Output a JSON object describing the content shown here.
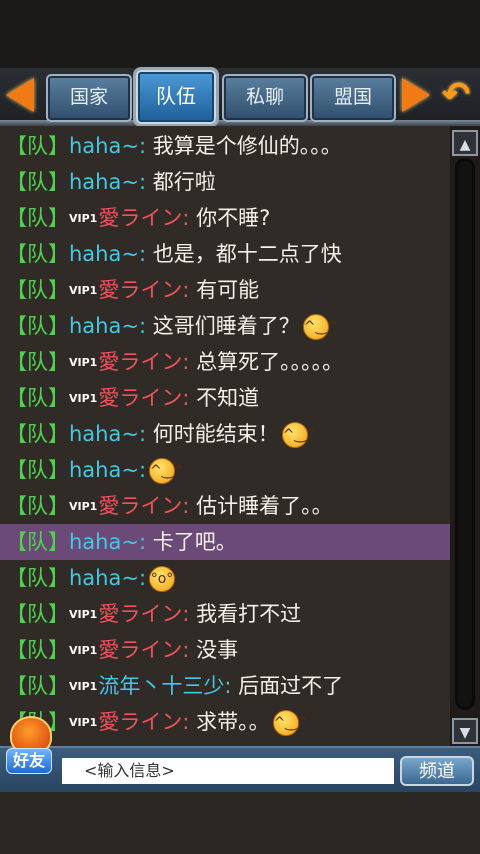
{
  "tabs": [
    {
      "label": "国家",
      "active": false
    },
    {
      "label": "队伍",
      "active": true
    },
    {
      "label": "私聊",
      "active": false
    },
    {
      "label": "盟国",
      "active": false
    }
  ],
  "messages": [
    {
      "channel": "【队】",
      "vip": "",
      "name": "haha~:",
      "text": " 我算是个修仙的。。。",
      "emoji": ""
    },
    {
      "channel": "【队】",
      "vip": "",
      "name": "haha~:",
      "text": " 都行啦",
      "emoji": ""
    },
    {
      "channel": "【队】",
      "vip": "VIP1",
      "name": "愛ライン:",
      "text": " 你不睡?",
      "emoji": ""
    },
    {
      "channel": "【队】",
      "vip": "",
      "name": "haha~:",
      "text": " 也是，都十二点了快",
      "emoji": ""
    },
    {
      "channel": "【队】",
      "vip": "VIP1",
      "name": "愛ライン:",
      "text": " 有可能",
      "emoji": ""
    },
    {
      "channel": "【队】",
      "vip": "",
      "name": "haha~:",
      "text": " 这哥们睡着了？",
      "emoji": "smile"
    },
    {
      "channel": "【队】",
      "vip": "VIP1",
      "name": "愛ライン:",
      "text": " 总算死了。。。。。",
      "emoji": ""
    },
    {
      "channel": "【队】",
      "vip": "VIP1",
      "name": "愛ライン:",
      "text": " 不知道",
      "emoji": ""
    },
    {
      "channel": "【队】",
      "vip": "",
      "name": "haha~:",
      "text": " 何时能结束！",
      "emoji": "smile"
    },
    {
      "channel": "【队】",
      "vip": "",
      "name": "haha~:",
      "text": "",
      "emoji": "smile"
    },
    {
      "channel": "【队】",
      "vip": "VIP1",
      "name": "愛ライン:",
      "text": " 估计睡着了。。",
      "emoji": ""
    },
    {
      "channel": "【队】",
      "vip": "",
      "name": "haha~:",
      "text": " 卡了吧。",
      "emoji": "",
      "selected": true
    },
    {
      "channel": "【队】",
      "vip": "",
      "name": "haha~:",
      "text": "",
      "emoji": "surprised"
    },
    {
      "channel": "【队】",
      "vip": "VIP1",
      "name": "愛ライン:",
      "text": " 我看打不过",
      "emoji": ""
    },
    {
      "channel": "【队】",
      "vip": "VIP1",
      "name": "愛ライン:",
      "text": " 没事",
      "emoji": ""
    },
    {
      "channel": "【队】",
      "vip": "VIP1",
      "name": "流年丶十三少:",
      "text": " 后面过不了",
      "emoji": ""
    },
    {
      "channel": "【队】",
      "vip": "VIP1",
      "name": "愛ライン:",
      "text": " 求带。。",
      "emoji": "smile"
    }
  ],
  "input": {
    "placeholder": "<输入信息>"
  },
  "channel_button": "频道",
  "friend_label": "好友",
  "colors": {
    "channel": "#4fd04f",
    "cyan_name": "#44c8e6",
    "red_name": "#f0525c",
    "highlight": "#6b4a77"
  }
}
